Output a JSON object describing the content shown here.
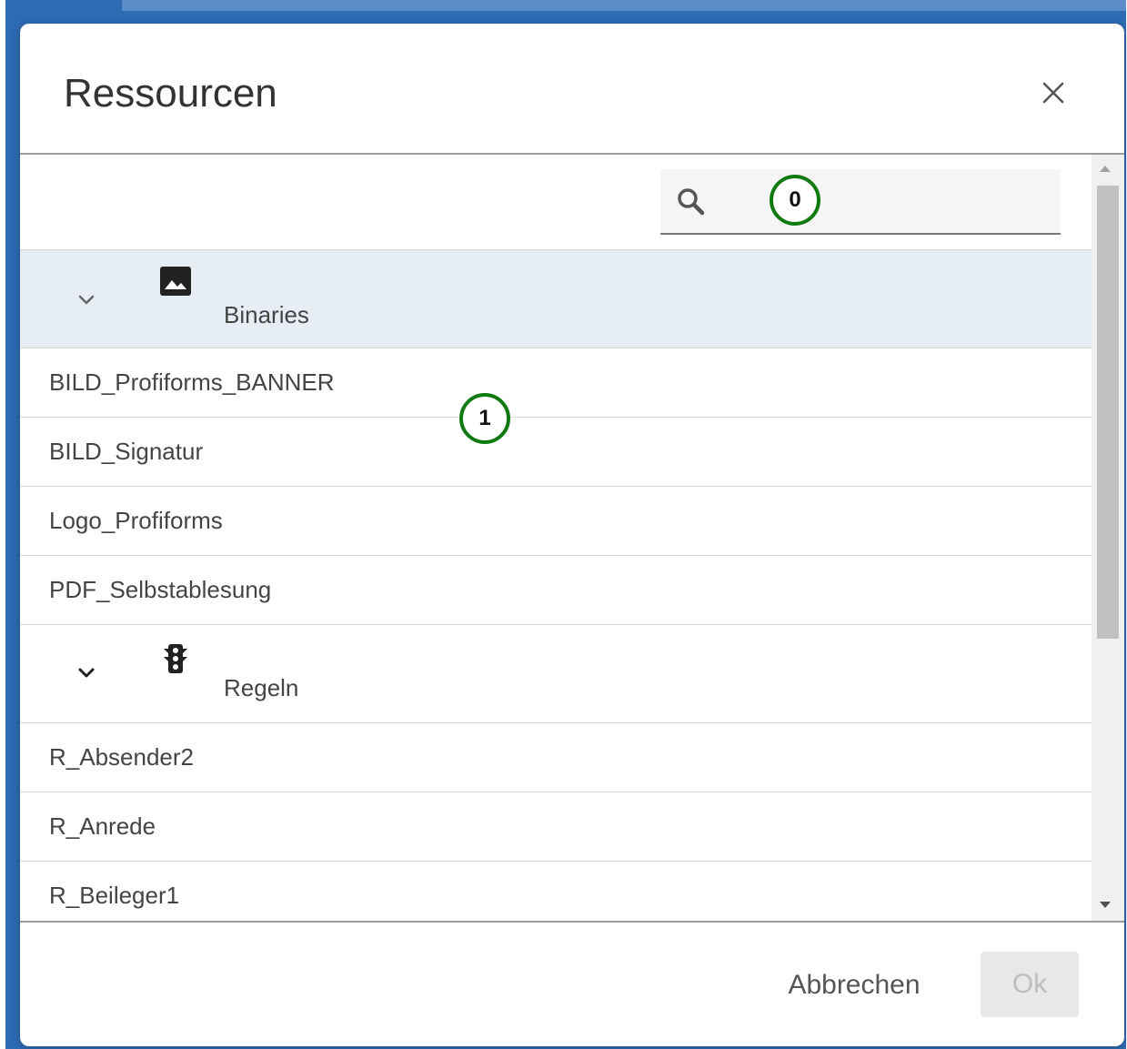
{
  "dialog": {
    "title": "Ressourcen",
    "close_icon": "close-icon"
  },
  "search": {
    "placeholder": "",
    "value": "",
    "icon": "search-icon"
  },
  "annotations": {
    "badge_0": "0",
    "badge_1": "1",
    "color": "#0f7a0f"
  },
  "groups": [
    {
      "label": "Binaries",
      "icon": "image-icon",
      "expanded": true,
      "items": [
        "BILD_Profiforms_BANNER",
        "BILD_Signatur",
        "Logo_Profiforms",
        "PDF_Selbstablesung"
      ]
    },
    {
      "label": "Regeln",
      "icon": "traffic-light-icon",
      "expanded": true,
      "items": [
        "R_Absender2",
        "R_Anrede",
        "R_Beileger1"
      ]
    }
  ],
  "footer": {
    "cancel_label": "Abbrechen",
    "ok_label": "Ok"
  },
  "colors": {
    "accent_bg": "#2d6bb3",
    "group_highlight": "#e6edf5"
  }
}
